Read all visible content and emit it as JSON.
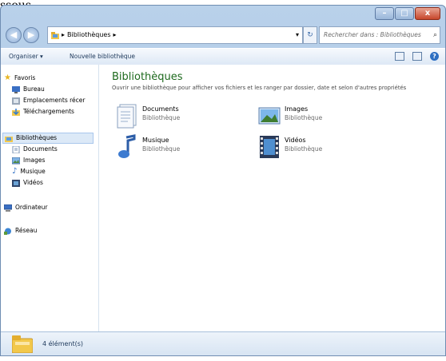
{
  "stub": "ssous,",
  "window": {
    "controls": {
      "minimize": "–",
      "maximize": "□",
      "close": "x"
    },
    "address": {
      "back": "◀",
      "forward": "▶",
      "breadcrumb": "Bibliothèques",
      "separator": "▸",
      "dropdown": "▾",
      "refresh": "↻",
      "search_placeholder": "Rechercher dans : Bibliothèques"
    },
    "toolbar": {
      "organize": "Organiser ▾",
      "new_library": "Nouvelle bibliothèque"
    },
    "nav": {
      "favoris": "Favoris",
      "bureau": "Bureau",
      "emplacements": "Emplacements récer",
      "telechargements": "Téléchargements",
      "bibliotheques": "Bibliothèques",
      "documents": "Documents",
      "images": "Images",
      "musique": "Musique",
      "videos": "Vidéos",
      "ordinateur": "Ordinateur",
      "reseau": "Réseau"
    },
    "main": {
      "title": "Bibliothèques",
      "description": "Ouvrir une bibliothèque pour afficher vos fichiers et les ranger par dossier, date et selon d'autres propriétés",
      "libraries": [
        {
          "name": "Documents",
          "type": "Bibliothèque"
        },
        {
          "name": "Images",
          "type": "Bibliothèque"
        },
        {
          "name": "Musique",
          "type": "Bibliothèque"
        },
        {
          "name": "Vidéos",
          "type": "Bibliothèque"
        }
      ]
    },
    "status": {
      "count": "4 élément(s)"
    }
  }
}
